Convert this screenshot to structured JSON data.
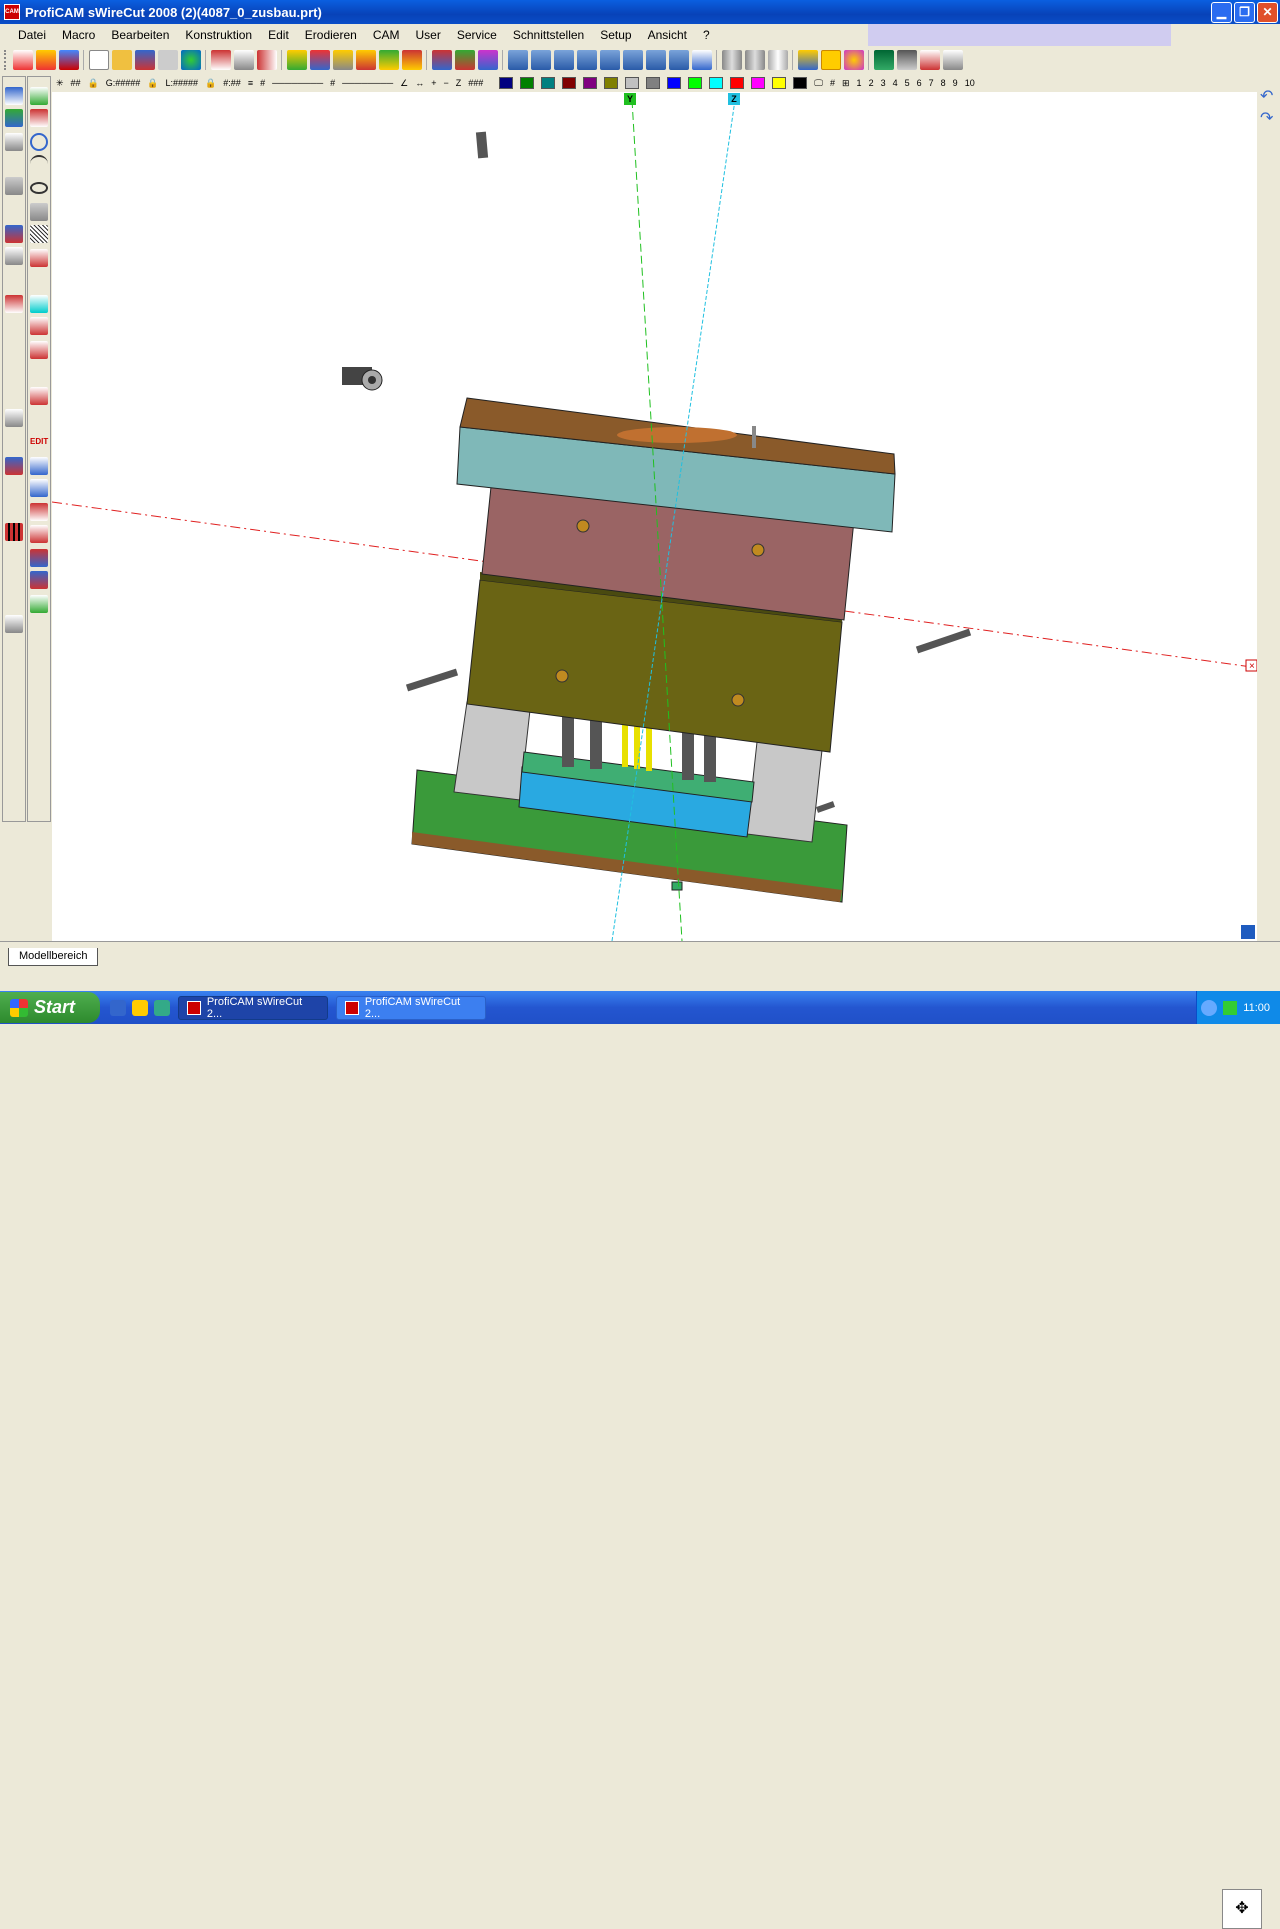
{
  "window": {
    "title": "ProfiCAM sWireCut 2008 (2)(4087_0_zusbau.prt)",
    "controls": [
      "minimize",
      "restore",
      "close"
    ]
  },
  "menubar": {
    "items": [
      "Datei",
      "Macro",
      "Bearbeiten",
      "Konstruktion",
      "Edit",
      "Erodieren",
      "CAM",
      "User",
      "Service",
      "Schnittstellen",
      "Setup",
      "Ansicht",
      "?"
    ]
  },
  "toolbar2": {
    "fields": [
      "##",
      "G:#####",
      "L:#####",
      "#:##",
      "#",
      "#",
      "###"
    ],
    "layer_numbers": [
      "1",
      "2",
      "3",
      "4",
      "5",
      "6",
      "7",
      "8",
      "9",
      "10"
    ],
    "colors": [
      "#000080",
      "#008000",
      "#008080",
      "#800000",
      "#800080",
      "#808000",
      "#c0c0c0",
      "#808080",
      "#0000ff",
      "#00ff00",
      "#00ffff",
      "#ff0000",
      "#ff00ff",
      "#ffff00",
      "#000000"
    ]
  },
  "canvas": {
    "axis_labels": {
      "y": "Y",
      "z": "Z"
    },
    "model_colors": {
      "top_plate": "#8a5a2a",
      "top_plate_edge": "#7fb8b8",
      "upper_block": "#9a6464",
      "middle_block": "#6a6414",
      "bottom_plate": "#3a9a3a",
      "blue_plate": "#29a9e1",
      "pillars": "#c8c8c8"
    }
  },
  "tabs": {
    "model": "Modellbereich"
  },
  "taskbar": {
    "start": "Start",
    "tasks": [
      "ProfiCAM sWireCut 2...",
      "ProfiCAM sWireCut 2..."
    ],
    "clock": "11:00"
  }
}
